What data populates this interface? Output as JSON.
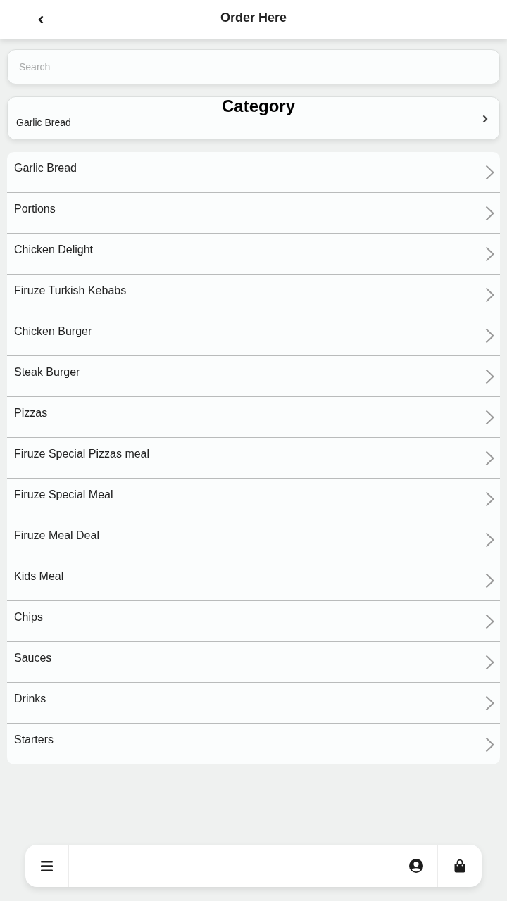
{
  "header": {
    "title": "Order Here"
  },
  "search": {
    "placeholder": "Search"
  },
  "category": {
    "title": "Category",
    "value": "Garlic Bread"
  },
  "items": [
    {
      "label": "Garlic Bread"
    },
    {
      "label": "Portions"
    },
    {
      "label": "Chicken Delight"
    },
    {
      "label": "Firuze Turkish Kebabs"
    },
    {
      "label": "Chicken Burger"
    },
    {
      "label": "Steak Burger"
    },
    {
      "label": "Pizzas"
    },
    {
      "label": "Firuze Special Pizzas meal"
    },
    {
      "label": "Firuze Special Meal"
    },
    {
      "label": "Firuze Meal Deal"
    },
    {
      "label": "Kids Meal"
    },
    {
      "label": "Chips"
    },
    {
      "label": "Sauces"
    },
    {
      "label": "Drinks"
    },
    {
      "label": "Starters"
    }
  ],
  "bottom_nav": [
    {
      "kind": "menu"
    },
    {
      "kind": "spacer"
    },
    {
      "kind": "account"
    },
    {
      "kind": "bag"
    }
  ]
}
